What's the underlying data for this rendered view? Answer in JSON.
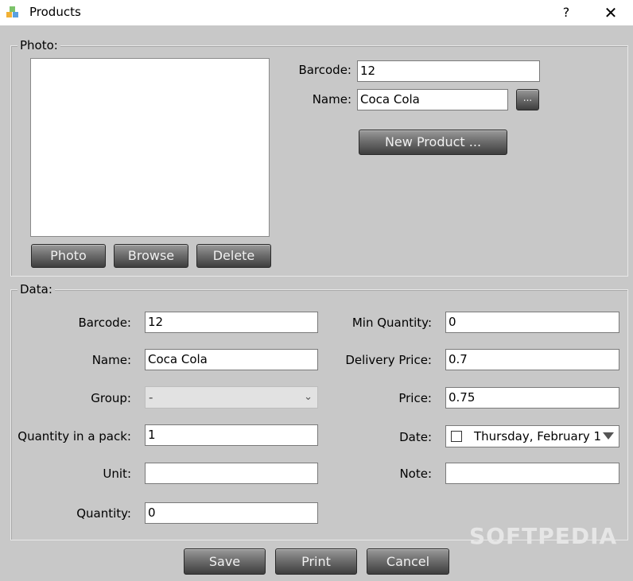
{
  "window": {
    "title": "Products",
    "help": "?",
    "close": "✕"
  },
  "photo_group": {
    "label": "Photo:",
    "buttons": {
      "photo": "Photo",
      "browse": "Browse",
      "delete": "Delete"
    }
  },
  "top_fields": {
    "barcode_label": "Barcode:",
    "barcode_value": "12",
    "name_label": "Name:",
    "name_value": "Coca Cola",
    "ellipsis": "...",
    "new_product": "New Product ..."
  },
  "data_group": {
    "label": "Data:",
    "barcode_label": "Barcode:",
    "barcode_value": "12",
    "name_label": "Name:",
    "name_value": "Coca Cola",
    "group_label": "Group:",
    "group_value": "-",
    "qty_pack_label": "Quantity in a pack:",
    "qty_pack_value": "1",
    "unit_label": "Unit:",
    "unit_value": "",
    "quantity_label": "Quantity:",
    "quantity_value": "0",
    "min_qty_label": "Min Quantity:",
    "min_qty_value": "0",
    "delivery_label": "Delivery Price:",
    "delivery_value": "0.7",
    "price_label": "Price:",
    "price_value": "0.75",
    "date_label": "Date:",
    "date_value": "Thursday, February 1",
    "note_label": "Note:",
    "note_value": ""
  },
  "footer": {
    "save": "Save",
    "print": "Print",
    "cancel": "Cancel"
  },
  "watermark": "SOFTPEDIA"
}
